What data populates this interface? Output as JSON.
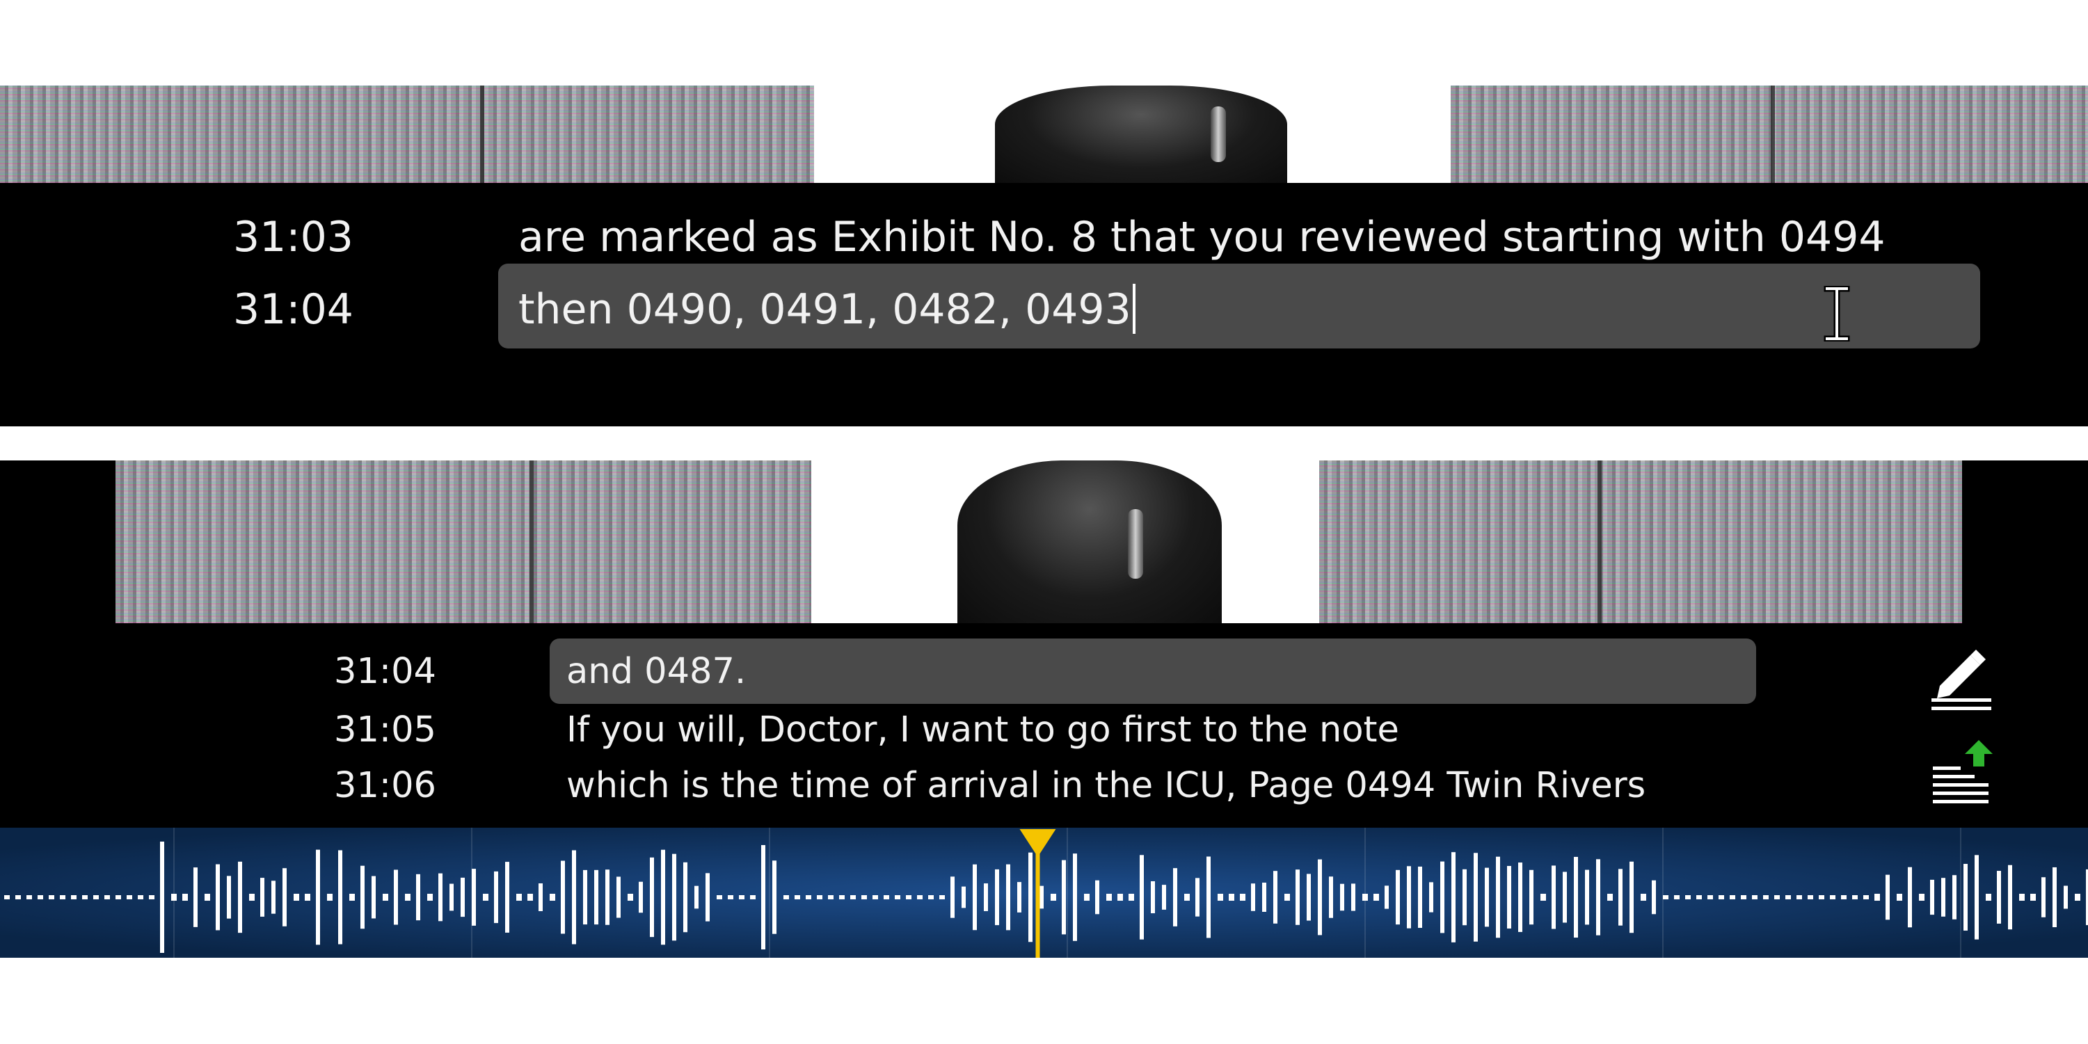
{
  "top_panel": {
    "lines": [
      {
        "time": "31:03",
        "text": "are marked as Exhibit No. 8 that you reviewed starting with 0494"
      },
      {
        "time": "31:04",
        "text": "then 0490, 0491, 0482, 0493"
      }
    ]
  },
  "bottom_panel": {
    "lines": [
      {
        "time": "31:04",
        "text": "and 0487."
      },
      {
        "time": "31:05",
        "text": "If you will, Doctor, I want to go first to the note"
      },
      {
        "time": "31:06",
        "text": "which is the time of arrival in the ICU, Page 0494 Twin Rivers"
      }
    ],
    "icons": {
      "edit": "edit-pencil-icon",
      "upload": "upload-text-icon"
    }
  },
  "colors": {
    "panel_bg": "#000000",
    "edit_box": "#4a4a4a",
    "text": "#f2f2f2",
    "waveform_bg": "#0b2b55",
    "waveform_bar": "#ffffff",
    "playhead": "#f5c400",
    "upload_arrow": "#2fb52f"
  },
  "waveform": {
    "playhead_fraction": 0.497
  }
}
